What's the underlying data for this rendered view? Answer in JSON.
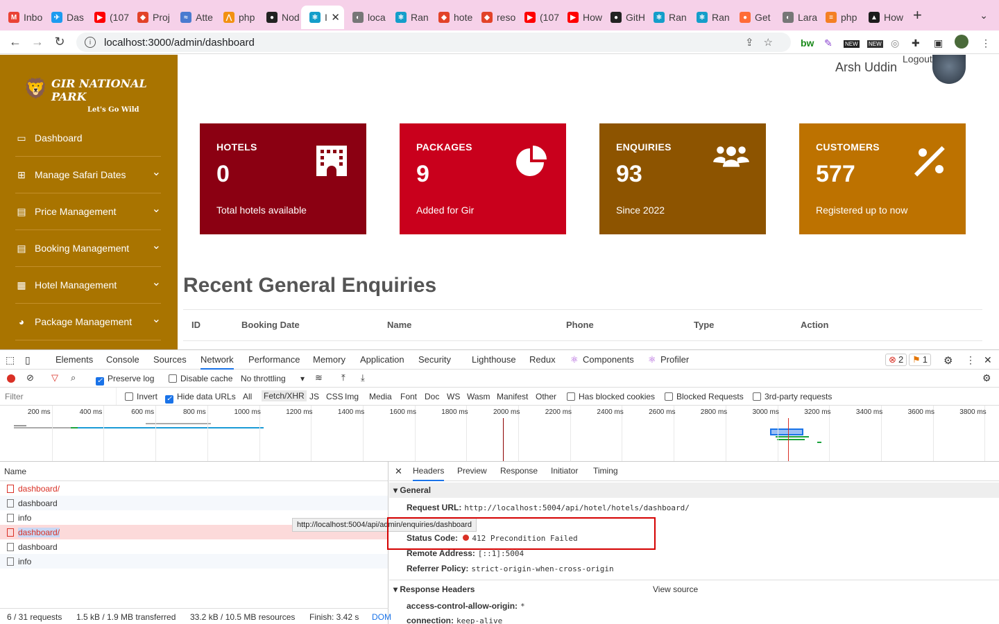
{
  "browser": {
    "tabs": [
      {
        "label": "Inbo",
        "icon": "gmail-icon",
        "color": "#ea4335"
      },
      {
        "label": "Das",
        "icon": "bird-icon",
        "color": "#1d9bf0"
      },
      {
        "label": "(107",
        "icon": "youtube-icon",
        "color": "#ff0000"
      },
      {
        "label": "Proj",
        "icon": "gitlab-icon",
        "color": "#e24329"
      },
      {
        "label": "Atte",
        "icon": "chart-icon",
        "color": "#4a7bd0"
      },
      {
        "label": "php",
        "icon": "pma-icon",
        "color": "#f29111"
      },
      {
        "label": "Nod",
        "icon": "github-icon",
        "color": "#222"
      },
      {
        "label": "I",
        "icon": "react-icon",
        "color": "#149eca",
        "active": true
      },
      {
        "label": "loca",
        "icon": "globe-icon",
        "color": "#777"
      },
      {
        "label": "Ran",
        "icon": "react-icon",
        "color": "#149eca"
      },
      {
        "label": "hote",
        "icon": "gitlab-icon",
        "color": "#e24329"
      },
      {
        "label": "reso",
        "icon": "gitlab-icon",
        "color": "#e24329"
      },
      {
        "label": "(107",
        "icon": "youtube-icon",
        "color": "#ff0000"
      },
      {
        "label": "How",
        "icon": "youtube-icon",
        "color": "#ff0000"
      },
      {
        "label": "GitH",
        "icon": "github-icon",
        "color": "#222"
      },
      {
        "label": "Ran",
        "icon": "react-icon",
        "color": "#149eca"
      },
      {
        "label": "Ran",
        "icon": "react-icon",
        "color": "#149eca"
      },
      {
        "label": "Get",
        "icon": "postman-icon",
        "color": "#ff6c37"
      },
      {
        "label": "Lara",
        "icon": "globe-icon",
        "color": "#777"
      },
      {
        "label": "php",
        "icon": "stackoverflow-icon",
        "color": "#f48024"
      },
      {
        "label": "How",
        "icon": "dev-icon",
        "color": "#1c1c1c"
      }
    ],
    "url": "localhost:3000/admin/dashboard"
  },
  "app": {
    "logo_title": "GIR NATIONAL PARK",
    "logo_tagline": "Let's Go Wild",
    "user_name": "Arsh Uddin",
    "logout": "Logout",
    "nav": [
      {
        "label": "Dashboard",
        "icon": "monitor-icon",
        "chevron": false
      },
      {
        "label": "Manage Safari Dates",
        "icon": "grid-icon",
        "chevron": true
      },
      {
        "label": "Price Management",
        "icon": "briefcase-icon",
        "chevron": true
      },
      {
        "label": "Booking Management",
        "icon": "briefcase-icon",
        "chevron": true
      },
      {
        "label": "Hotel Management",
        "icon": "building-icon",
        "chevron": true
      },
      {
        "label": "Package Management",
        "icon": "pie-icon",
        "chevron": true
      }
    ],
    "cards": [
      {
        "label": "HOTELS",
        "value": "0",
        "sub": "Total hotels available",
        "color": "#8b0012",
        "icon": "hotel-icon"
      },
      {
        "label": "PACKAGES",
        "value": "9",
        "sub": "Added for Gir",
        "color": "#c9001c",
        "icon": "pie-chart-icon"
      },
      {
        "label": "ENQUIRIES",
        "value": "93",
        "sub": "Since 2022",
        "color": "#8d5400",
        "icon": "users-icon"
      },
      {
        "label": "CUSTOMERS",
        "value": "577",
        "sub": "Registered up to now",
        "color": "#bd7200",
        "icon": "percent-icon"
      }
    ],
    "recent_title": "Recent General Enquiries",
    "table_headers": [
      "ID",
      "Booking Date",
      "Name",
      "Phone",
      "Type",
      "Action"
    ]
  },
  "devtools": {
    "tabs": [
      "Elements",
      "Console",
      "Sources",
      "Network",
      "Performance",
      "Memory",
      "Application",
      "Security",
      "Lighthouse",
      "Redux",
      "Components",
      "Profiler"
    ],
    "errors": "2",
    "warnings": "1",
    "preserve_log": "Preserve log",
    "disable_cache": "Disable cache",
    "throttling": "No throttling",
    "filter_placeholder": "Filter",
    "filter_options": [
      "Invert",
      "Hide data URLs",
      "All",
      "Fetch/XHR",
      "JS",
      "CSS",
      "Img",
      "Media",
      "Font",
      "Doc",
      "WS",
      "Wasm",
      "Manifest",
      "Other",
      "Has blocked cookies",
      "Blocked Requests",
      "3rd-party requests"
    ],
    "timeline_ticks": [
      "200 ms",
      "400 ms",
      "600 ms",
      "800 ms",
      "1000 ms",
      "1200 ms",
      "1400 ms",
      "1600 ms",
      "1800 ms",
      "2000 ms",
      "2200 ms",
      "2400 ms",
      "2600 ms",
      "2800 ms",
      "3000 ms",
      "3200 ms",
      "3400 ms",
      "3600 ms",
      "3800 ms"
    ],
    "name_header": "Name",
    "requests": [
      {
        "name": "dashboard/",
        "error": true
      },
      {
        "name": "dashboard",
        "error": false
      },
      {
        "name": "info",
        "error": false
      },
      {
        "name": "dashboard/",
        "error": true,
        "selected": true
      },
      {
        "name": "dashboard",
        "error": false
      },
      {
        "name": "info",
        "error": false
      }
    ],
    "tooltip": "http://localhost:5004/api/admin/enquiries/dashboard",
    "status": {
      "requests": "6 / 31 requests",
      "transferred": "1.5 kB / 1.9 MB transferred",
      "resources": "33.2 kB / 10.5 MB resources",
      "finish": "Finish: 3.42 s",
      "dom": "DOM"
    },
    "detail_tabs": [
      "Headers",
      "Preview",
      "Response",
      "Initiator",
      "Timing"
    ],
    "general_title": "General",
    "request_url_label": "Request URL:",
    "request_url": "http://localhost:5004/api/hotel/hotels/dashboard/",
    "status_code_label": "Status Code:",
    "status_code": "412 Precondition Failed",
    "remote_label": "Remote Address:",
    "remote": "[::1]:5004",
    "referrer_label": "Referrer Policy:",
    "referrer": "strict-origin-when-cross-origin",
    "response_headers_title": "Response Headers",
    "view_source": "View source",
    "acao_label": "access-control-allow-origin:",
    "acao": "*",
    "connection_label": "connection:",
    "connection": "keep-alive"
  }
}
